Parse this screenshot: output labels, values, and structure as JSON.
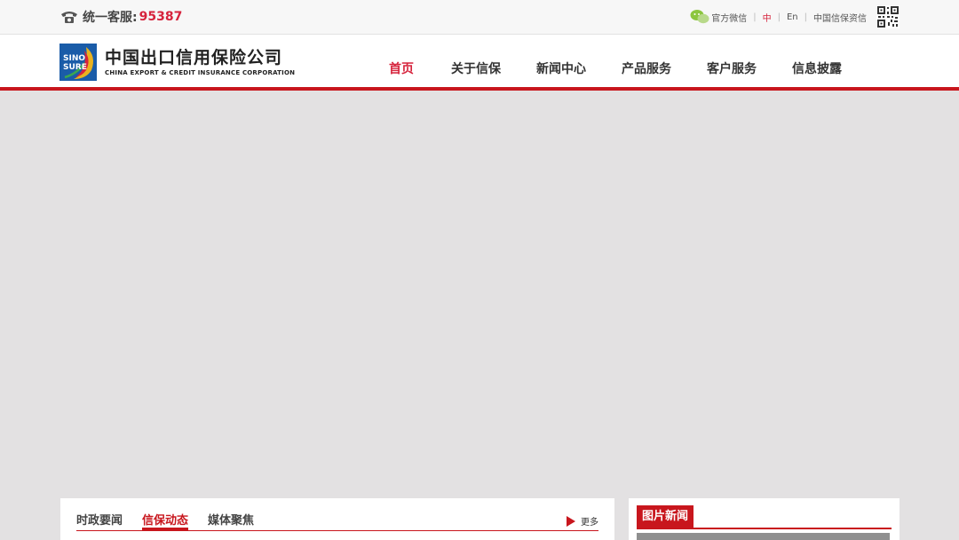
{
  "topbar": {
    "hotline_label": "统一客服:",
    "hotline_number": "95387",
    "links": {
      "wechat": "官方微信",
      "lang_zh": "中",
      "lang_en": "En",
      "sinosure_info": "中国信保资信"
    },
    "separator": "|"
  },
  "header": {
    "logo_mark": "SINO SURE",
    "logo_cn": "中国出口信用保险公司",
    "logo_en": "CHINA EXPORT & CREDIT INSURANCE CORPORATION"
  },
  "nav": {
    "items": [
      "首页",
      "关于信保",
      "新闻中心",
      "产品服务",
      "客户服务",
      "信息披露"
    ],
    "active": "首页"
  },
  "news": {
    "tabs": [
      "时政要闻",
      "信保动态",
      "媒体聚焦"
    ],
    "active_tab": "信保动态",
    "more": "更多"
  },
  "photo_news": {
    "title": "图片新闻"
  },
  "colors": {
    "brand_red": "#c8161d",
    "accent_red": "#d6233c",
    "logo_blue": "#1a5ca8"
  },
  "icons": [
    "phone-icon",
    "wechat-icon",
    "qr-code-icon",
    "play-arrow-icon",
    "sinosure-logo-icon"
  ]
}
